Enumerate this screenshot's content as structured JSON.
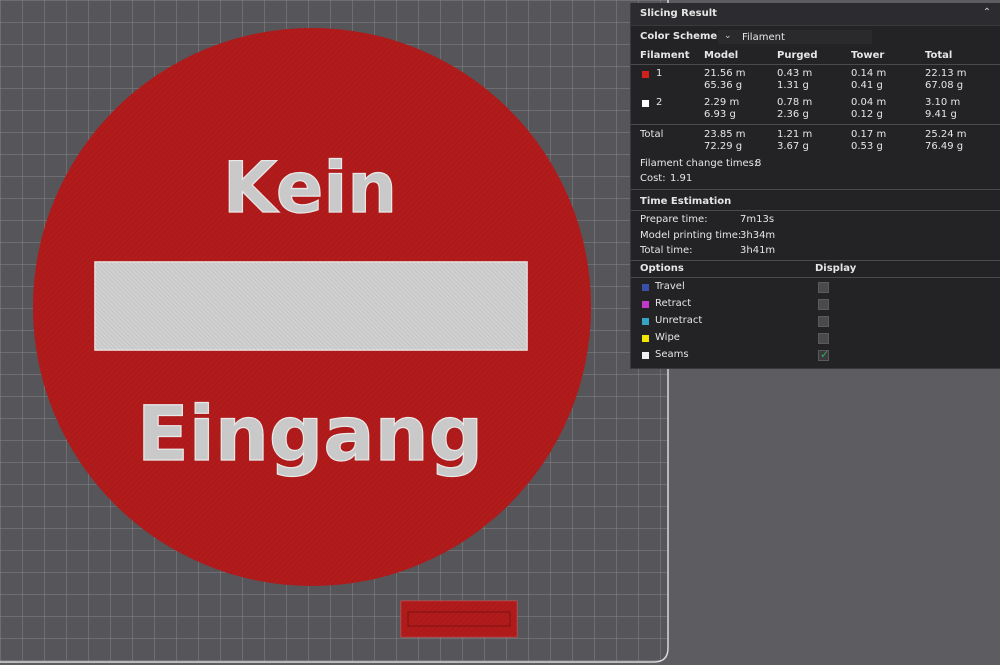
{
  "model": {
    "top_text": "Kein",
    "bottom_text": "Eingang"
  },
  "panel": {
    "title": "Slicing Result",
    "color_scheme_label": "Color Scheme",
    "color_scheme_value": "Filament",
    "table": {
      "headers": [
        "Filament",
        "Model",
        "Purged",
        "Tower",
        "Total"
      ],
      "rows": [
        {
          "id": "1",
          "color": "#d22020",
          "model": [
            "21.56 m",
            "65.36 g"
          ],
          "purged": [
            "0.43 m",
            "1.31 g"
          ],
          "tower": [
            "0.14 m",
            "0.41 g"
          ],
          "total": [
            "22.13 m",
            "67.08 g"
          ]
        },
        {
          "id": "2",
          "color": "#ffffff",
          "model": [
            "2.29 m",
            "6.93 g"
          ],
          "purged": [
            "0.78 m",
            "2.36 g"
          ],
          "tower": [
            "0.04 m",
            "0.12 g"
          ],
          "total": [
            "3.10 m",
            "9.41 g"
          ]
        }
      ],
      "total_row": {
        "label": "Total",
        "model": [
          "23.85 m",
          "72.29 g"
        ],
        "purged": [
          "1.21 m",
          "3.67 g"
        ],
        "tower": [
          "0.17 m",
          "0.53 g"
        ],
        "total": [
          "25.24 m",
          "76.49 g"
        ]
      }
    },
    "filament_change_label": "Filament change times:",
    "filament_change_value": "8",
    "cost_label": "Cost:",
    "cost_value": "1.91",
    "time_section_title": "Time Estimation",
    "time_rows": [
      {
        "label": "Prepare time:",
        "value": "7m13s"
      },
      {
        "label": "Model printing time:",
        "value": "3h34m"
      },
      {
        "label": "Total time:",
        "value": "3h41m"
      }
    ],
    "options_header": "Options",
    "display_header": "Display",
    "options": [
      {
        "label": "Travel",
        "color": "#3a4fa8",
        "checked": false
      },
      {
        "label": "Retract",
        "color": "#c238c8",
        "checked": false
      },
      {
        "label": "Unretract",
        "color": "#33a4c4",
        "checked": false
      },
      {
        "label": "Wipe",
        "color": "#f2e600",
        "checked": false
      },
      {
        "label": "Seams",
        "color": "#f0f0f0",
        "checked": true
      }
    ]
  }
}
